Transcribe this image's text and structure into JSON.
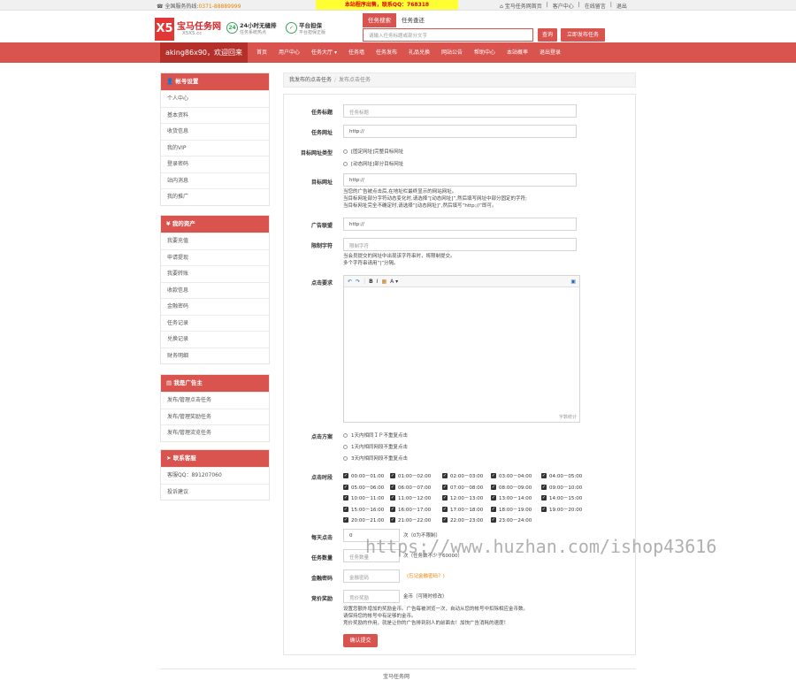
{
  "topbar": {
    "hotline_label": "全国服务热线:",
    "hotline": "0371-88889999",
    "notice": "本站程序出售，联系QQ：768318",
    "links": [
      "宝马任务网首页",
      "客户中心",
      "在线留言",
      "退出"
    ]
  },
  "header": {
    "logo_mark": "X5",
    "logo_name": "宝马任务网",
    "logo_sub": "X5X5.cc",
    "features": [
      {
        "icon": "24",
        "title": "24小时无缝排",
        "desc": "任务系统热点"
      },
      {
        "icon": "✓",
        "title": "平台担保",
        "desc": "平台担保正版"
      }
    ],
    "search_tabs": [
      "任务搜索",
      "任务查还"
    ],
    "search_placeholder": "请输入任务标题或部分文字",
    "search_button": "查询",
    "publish_button": "立即发布任务"
  },
  "nav": {
    "welcome": "aking86x90，欢迎回来",
    "items": [
      "首页",
      "用户中心",
      "任务大厅 ▾",
      "任务墙",
      "任务发布",
      "礼品兑换",
      "网站公告",
      "帮助中心",
      "本站概率",
      "退出登录"
    ]
  },
  "sidebar": {
    "groups": [
      {
        "title": "帐号设置",
        "icon": "user-icon",
        "items": [
          "个人中心",
          "基本资料",
          "收货信息",
          "我的VIP",
          "登录密码",
          "站内消息",
          "我的推广"
        ]
      },
      {
        "title": "我的资产",
        "icon": "yen-icon",
        "items": [
          "我要充值",
          "申请提现",
          "我要转账",
          "收款信息",
          "金融密码",
          "任务记录",
          "兑换记录",
          "财务明细"
        ]
      },
      {
        "title": "我是广告主",
        "icon": "list-icon",
        "items": [
          "发布/管理点击任务",
          "发布/管理奖励任务",
          "发布/管理流览任务"
        ]
      },
      {
        "title": "联系客服",
        "icon": "send-icon",
        "items": [
          "客服QQ：891207060",
          "投诉建议"
        ]
      }
    ]
  },
  "breadcrumb": {
    "root": "我发布的点击任务",
    "current": "发布点击任务"
  },
  "form": {
    "title_label": "任务标题",
    "title_placeholder": "任务标题",
    "url_label": "任务网址",
    "url_value": "http://",
    "target_type_label": "目标网址类型",
    "target_types": [
      "[固定网址]完整目标网址",
      "[动态网址]部分目标网址"
    ],
    "target_url_label": "目标网址",
    "target_url_value": "http://",
    "target_note": [
      "当您的广告被点击后,在地址栏最终显示的网站网址。",
      "当目标网址部分字符动态变化时,请选择“[动态网址]”,然后填写网址中部分固定的字符;",
      "当目标网址完全不确定时,请选择“[动态网址]”,然后填写“http://”即可。"
    ],
    "ad_url_label": "广告联盟",
    "ad_url_value": "http://",
    "limit_label": "限制字符",
    "limit_placeholder": "限制字符",
    "limit_note": [
      "当会员提交的网址中出现该字符串时，将限制提交。",
      "多个字符串请用“|”分隔。"
    ],
    "click_req_label": "点击要求",
    "editor_toolbar": [
      "↶",
      "↷",
      "B",
      "I",
      "▦",
      "A ▾"
    ],
    "editor_wordcount": "字数统计",
    "scheme_label": "点击方案",
    "schemes": [
      "1天内相同ＩＰ不重复点击",
      "1天内相同网段不重复点击",
      "3天内相同网段不重复点击"
    ],
    "time_label": "点击时段",
    "time_slots": [
      "00:00－01:00",
      "01:00－02:00",
      "02:00－03:00",
      "03:00－04:00",
      "04:00－05:00",
      "05:00－06:00",
      "06:00－07:00",
      "07:00－08:00",
      "08:00－09:00",
      "09:00－10:00",
      "10:00－11:00",
      "11:00－12:00",
      "12:00－13:00",
      "13:00－14:00",
      "14:00－15:00",
      "15:00－16:00",
      "16:00－17:00",
      "17:00－18:00",
      "18:00－19:00",
      "19:00－20:00",
      "20:00－21:00",
      "21:00－22:00",
      "22:00－23:00",
      "23:00－24:00"
    ],
    "daily_label": "每天点击",
    "daily_value": "0",
    "daily_unit": "次（0为不限制）",
    "count_label": "任务数量",
    "count_placeholder": "任务数量",
    "count_unit": "次（任务数不少于60000）",
    "pwd_label": "金融密码",
    "pwd_placeholder": "金融密码",
    "pwd_link": "(忘记金融密码？)",
    "bid_label": "竞价奖励",
    "bid_placeholder": "竞价奖励",
    "bid_unit": "金币（可随时修改）",
    "bid_note": [
      "设置您额外增加的奖励金币。广告每被浏览一次，自动从您的帐号中扣除相应金币数。",
      "请保持您的帐号中有足够的金币。",
      "竞价奖励的作用，就是让你的广告排到别人的前面去！加快广告消耗的速度！"
    ],
    "submit": "确认提交"
  },
  "footer": "宝马任务网",
  "watermark": "https://www.huzhan.com/ishop43616"
}
